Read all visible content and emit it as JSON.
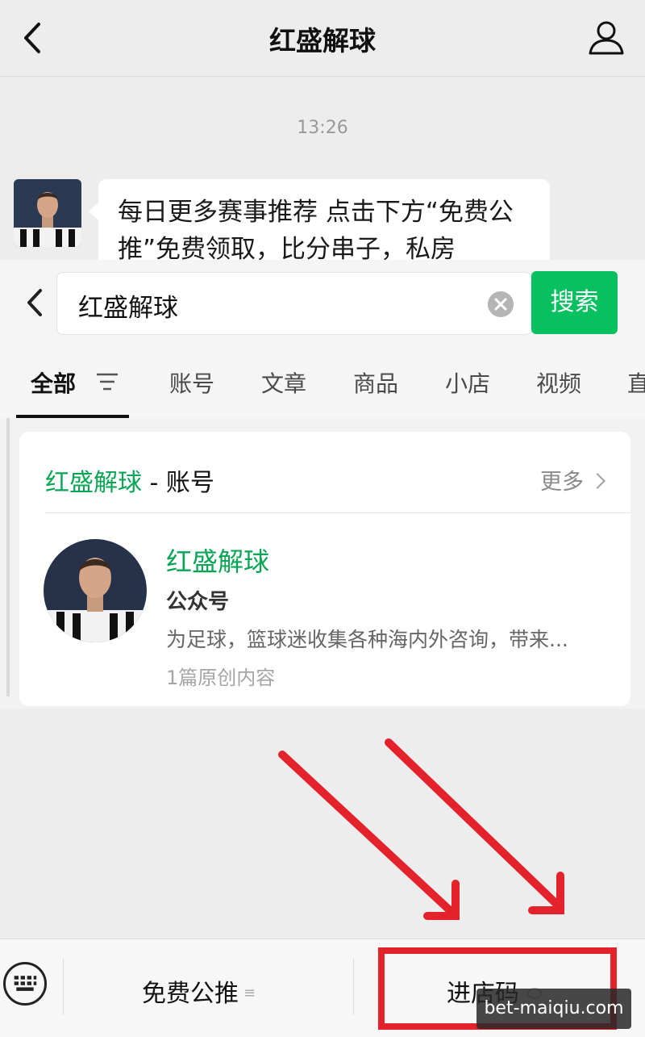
{
  "chat": {
    "title": "红盛解球",
    "timestamp": "13:26",
    "message": "每日更多赛事推荐 点击下方“免费公推”免费领取，比分串子，私房"
  },
  "search": {
    "query": "红盛解球",
    "button_label": "搜索",
    "tabs": [
      "全部",
      "账号",
      "文章",
      "商品",
      "小店",
      "视频",
      "直"
    ]
  },
  "result": {
    "section_title": "红盛解球",
    "section_suffix": " - 账号",
    "more_label": "更多",
    "account_name": "红盛解球",
    "account_type": "公众号",
    "description": "为足球，篮球迷收集各种海内外咨询，带来...",
    "stat": "1篇原创内容"
  },
  "menu": {
    "item1": "免费公推",
    "item2": "进店码"
  },
  "watermark": "bet-maiqiu.com",
  "colors": {
    "accent": "#07c160",
    "highlight": "#07a554",
    "annotation": "#e4222b"
  }
}
